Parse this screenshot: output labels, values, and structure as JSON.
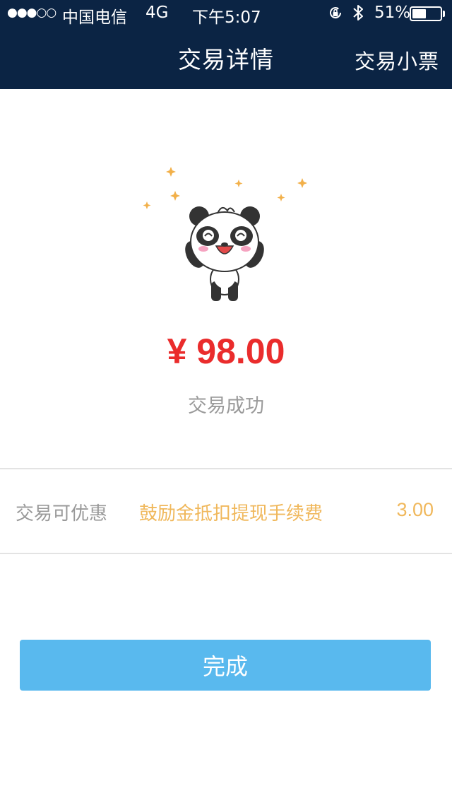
{
  "status_bar": {
    "signal": "●●●○○",
    "carrier": "中国电信",
    "network": "4G",
    "time": "下午5:07",
    "battery_percent": "51%",
    "battery_level": 0.51,
    "icons": [
      "orientation-lock-icon",
      "bluetooth-icon",
      "battery-icon"
    ]
  },
  "nav": {
    "title": "交易详情",
    "receipt_label": "交易小票"
  },
  "transaction": {
    "amount": "¥ 98.00",
    "status": "交易成功",
    "illustration": "panda-mascot"
  },
  "discount": {
    "label": "交易可优惠",
    "description": "鼓励金抵扣提现手续费",
    "value": "3.00"
  },
  "actions": {
    "done_label": "完成"
  },
  "colors": {
    "header_bg": "#0b2444",
    "amount": "#ea2c2c",
    "discount": "#f0b85c",
    "button": "#59b9ee"
  }
}
